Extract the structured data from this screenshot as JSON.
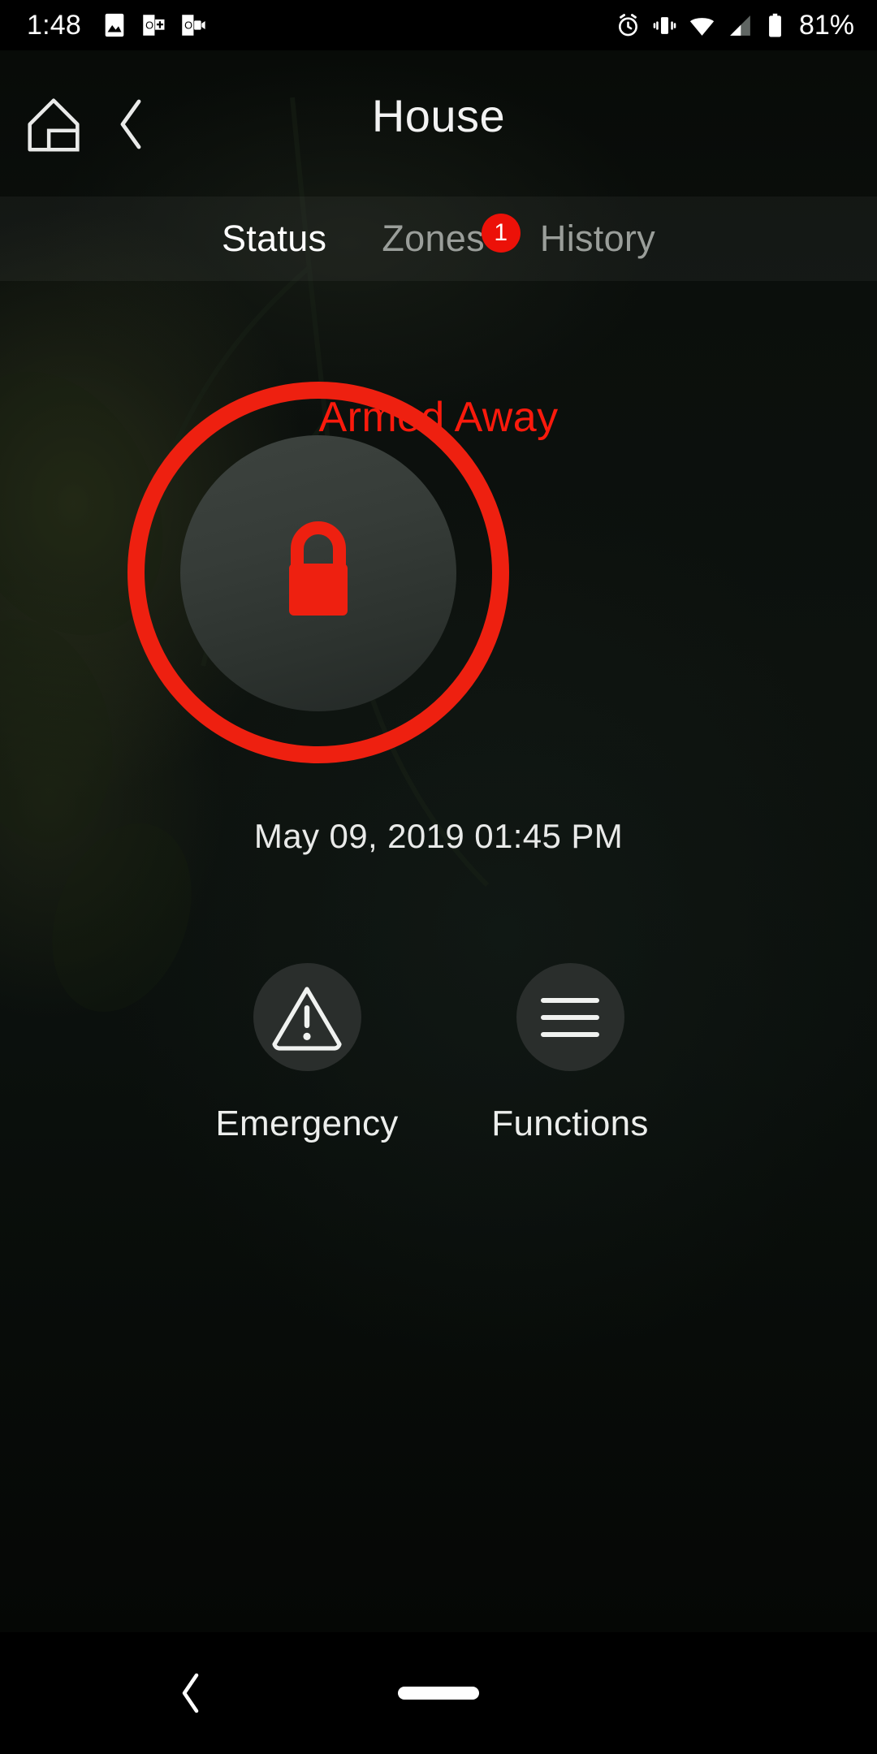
{
  "status_bar": {
    "clock": "1:48",
    "battery_percent": "81%",
    "left_icons": [
      "photo-icon",
      "office-word-icon",
      "office-outlook-icon"
    ],
    "right_icons": [
      "alarm-icon",
      "vibrate-icon",
      "wifi-icon",
      "cellular-signal-icon",
      "battery-icon"
    ]
  },
  "app_bar": {
    "home_icon": "home-icon",
    "back_icon": "chevron-left-icon",
    "title": "House"
  },
  "tabs": [
    {
      "label": "Status",
      "active": true,
      "badge": null
    },
    {
      "label": "Zones",
      "active": false,
      "badge": "1"
    },
    {
      "label": "History",
      "active": false,
      "badge": null
    }
  ],
  "main": {
    "arm_status": "Armed Away",
    "dial_icon": "lock-closed-icon",
    "timestamp": "May 09, 2019  01:45 PM"
  },
  "actions": [
    {
      "label": "Emergency",
      "icon": "warning-triangle-icon"
    },
    {
      "label": "Functions",
      "icon": "hamburger-menu-icon"
    }
  ],
  "nav_bar": {
    "back_icon": "nav-back-icon",
    "home_pill": "home-pill-icon"
  },
  "colors": {
    "alert_red": "#ee2010",
    "status_red": "#fa1a0c",
    "badge_red": "#ec1108",
    "dial_inner": "#363c38",
    "action_circle": "#2a2e2c",
    "tab_inactive": "#9a9e9a",
    "text_primary": "#ffffff",
    "background": "#0b100d"
  }
}
